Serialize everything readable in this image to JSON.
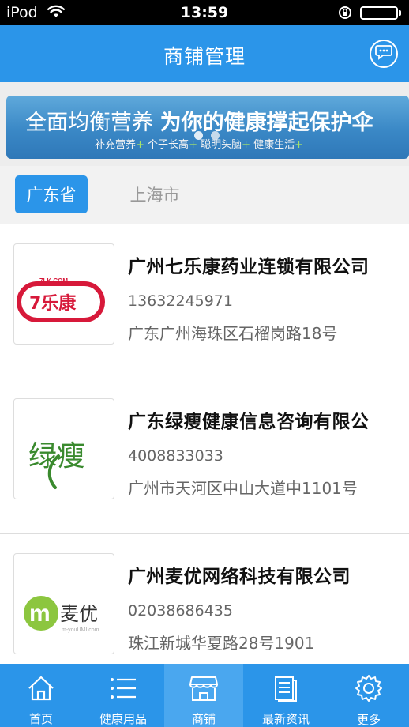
{
  "status_bar": {
    "carrier": "iPod",
    "time": "13:59",
    "battery_percent": 100
  },
  "nav": {
    "title": "商铺管理",
    "right_icon": "chat-bubble-icon"
  },
  "banner": {
    "headline_light": "全面均衡营养",
    "headline_bold": "为你的健康撑起保护伞",
    "sub_items": [
      "补充营养",
      "个子长高",
      "聪明头脑",
      "健康生活"
    ],
    "sub_separator": "+",
    "active_slide": 2,
    "slide_count": 2
  },
  "regions": {
    "active": "广东省",
    "inactive": "上海市"
  },
  "stores": [
    {
      "name": "广州七乐康药业连锁有限公司",
      "phone": "13632245971",
      "address": "广东广州海珠区石榴岗路18号",
      "logo_small": "7LK.COM",
      "logo_text": "7乐康"
    },
    {
      "name": "广东绿瘦健康信息咨询有限公",
      "phone": "4008833033",
      "address": "广州市天河区中山大道中1101号",
      "logo_text": "绿瘦"
    },
    {
      "name": "广州麦优网络科技有限公司",
      "phone": "02038686435",
      "address": "珠江新城华夏路28号1901",
      "logo_text": "麦优",
      "logo_small": "m-youUMI.com"
    }
  ],
  "tabbar": {
    "items": [
      {
        "label": "首页",
        "icon": "home-icon"
      },
      {
        "label": "健康用品",
        "icon": "list-icon"
      },
      {
        "label": "商铺",
        "icon": "store-icon"
      },
      {
        "label": "最新资讯",
        "icon": "document-icon"
      },
      {
        "label": "更多",
        "icon": "gear-icon"
      }
    ],
    "active_index": 2
  },
  "colors": {
    "primary": "#2b95e9",
    "tab_active_bg": "#4aa7ef",
    "logo_7lk_red": "#d7193a",
    "logo_lvshou_green": "#3a8a2e",
    "logo_maiyou_green": "#8cc63f"
  }
}
